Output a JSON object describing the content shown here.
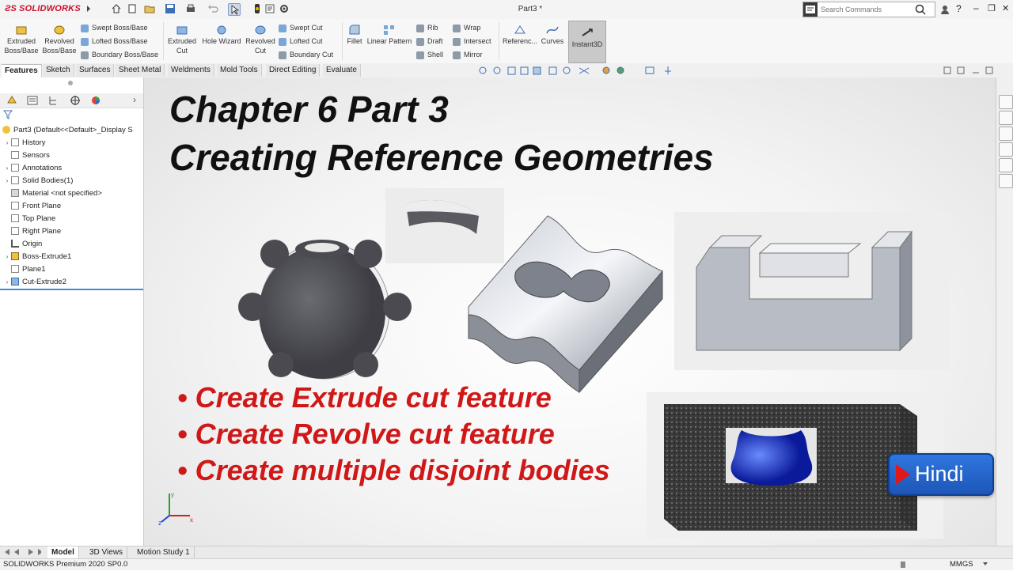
{
  "app": {
    "logo": "SOLIDWORKS",
    "doc_title": "Part3 *"
  },
  "search": {
    "placeholder": "Search Commands"
  },
  "window_controls": {
    "help": "?",
    "minimize": "–",
    "restore": "❐",
    "close": "✕"
  },
  "command_manager": {
    "extruded_boss": "Extruded\nBoss/Base",
    "revolved_boss": "Revolved\nBoss/Base",
    "swept_boss": "Swept Boss/Base",
    "lofted_boss": "Lofted Boss/Base",
    "boundary_boss": "Boundary Boss/Base",
    "extruded_cut": "Extruded\nCut",
    "hole_wizard": "Hole Wizard",
    "revolved_cut": "Revolved\nCut",
    "swept_cut": "Swept Cut",
    "lofted_cut": "Lofted Cut",
    "boundary_cut": "Boundary Cut",
    "fillet": "Fillet",
    "linear_pattern": "Linear Pattern",
    "rib": "Rib",
    "draft": "Draft",
    "shell": "Shell",
    "wrap": "Wrap",
    "intersect": "Intersect",
    "mirror": "Mirror",
    "reference": "Referenc...",
    "curves": "Curves",
    "instant3d": "Instant3D"
  },
  "tabs": [
    "Features",
    "Sketch",
    "Surfaces",
    "Sheet Metal",
    "Weldments",
    "Mold Tools",
    "Direct Editing",
    "Evaluate"
  ],
  "tree": {
    "root": "Part3  (Default<<Default>_Display S",
    "items": [
      "History",
      "Sensors",
      "Annotations",
      "Solid Bodies(1)",
      "Material <not specified>",
      "Front Plane",
      "Top Plane",
      "Right Plane",
      "Origin",
      "Boss-Extrude1",
      "Plane1",
      "Cut-Extrude2"
    ]
  },
  "slide": {
    "title1": "Chapter 6  Part 3",
    "title2": "Creating Reference Geometries",
    "bullets": [
      "• Create Extrude cut feature",
      "• Create Revolve cut feature",
      "• Create multiple disjoint bodies"
    ],
    "badge": "Hindi"
  },
  "triad": {
    "x": "x",
    "y": "y",
    "z": "z"
  },
  "bottom_tabs": [
    "Model",
    "3D Views",
    "Motion Study 1"
  ],
  "status": {
    "left": "SOLIDWORKS Premium 2020 SP0.0",
    "units": "MMGS"
  },
  "colors": {
    "title_text": "#111111",
    "bullet_text": "#d01818",
    "badge_bg": "#2f76e0",
    "logo": "#c8102e"
  }
}
